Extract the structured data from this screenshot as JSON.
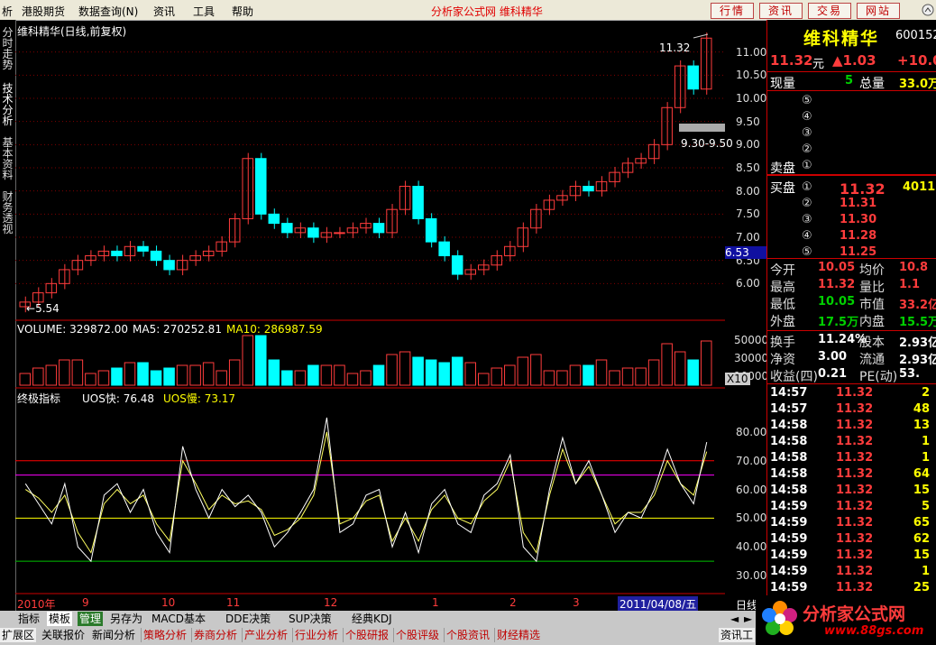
{
  "menubar": {
    "items": [
      "析",
      "港股期货",
      "数据查询(N)",
      "资讯",
      "工具",
      "帮助"
    ],
    "center_title": "分析家公式网  维科精华",
    "buttons": [
      "行情",
      "资讯",
      "交易",
      "网站"
    ]
  },
  "lefttabs": [
    "分时走势",
    "技术分析",
    "基本资料",
    "财务透视"
  ],
  "chart": {
    "price_title": "维科精华(日线,前复权)",
    "high_label": "11.32",
    "low_label": "5.54",
    "range_label": "9.30-9.50",
    "price_ticks": [
      "11.00",
      "10.50",
      "10.00",
      "9.50",
      "9.00",
      "8.50",
      "8.00",
      "7.50",
      "7.00",
      "6.50",
      "6.00"
    ],
    "cursor_price": "6.53",
    "volume_label": "VOLUME: 329872.00",
    "ma5_label": "MA5: 270252.81",
    "ma10_label": "MA10: 286987.59",
    "volume_ticks": [
      "50000",
      "30000",
      "10000"
    ],
    "volume_unit": "X10",
    "ind_title": "终极指标",
    "uos_fast": "UOS快: 76.48",
    "uos_slow": "UOS慢: 73.17",
    "ind_ticks": [
      "80.00",
      "70.00",
      "60.00",
      "50.00",
      "40.00",
      "30.00"
    ],
    "dates": [
      "2010年",
      "9",
      "10",
      "11",
      "12",
      "1",
      "2",
      "3"
    ],
    "cursor_date": "2011/04/08/五",
    "period": "日线"
  },
  "chart_data": {
    "type": "line",
    "title": "维科精华(日线,前复权)",
    "price": {
      "ylim": [
        5.5,
        11.5
      ],
      "high": 11.32,
      "low": 5.54,
      "values": [
        5.6,
        5.8,
        6.0,
        6.3,
        6.5,
        6.6,
        6.7,
        6.6,
        6.8,
        6.7,
        6.5,
        6.3,
        6.5,
        6.6,
        6.7,
        6.9,
        7.4,
        8.7,
        7.5,
        7.3,
        7.1,
        7.2,
        7.0,
        7.1,
        7.1,
        7.2,
        7.3,
        7.1,
        7.6,
        8.1,
        7.4,
        6.9,
        6.6,
        6.2,
        6.3,
        6.4,
        6.6,
        6.8,
        7.2,
        7.6,
        7.8,
        7.9,
        8.1,
        8.0,
        8.2,
        8.4,
        8.6,
        8.7,
        9.0,
        9.8,
        10.7,
        10.2,
        11.3
      ]
    },
    "uos": {
      "ylim": [
        25,
        90
      ],
      "lines": [
        35,
        50,
        65,
        70
      ],
      "fast": [
        62,
        55,
        48,
        62,
        40,
        35,
        58,
        62,
        52,
        60,
        45,
        38,
        75,
        60,
        50,
        60,
        54,
        58,
        52,
        40,
        45,
        52,
        60,
        85,
        45,
        48,
        58,
        60,
        40,
        52,
        38,
        55,
        60,
        48,
        45,
        58,
        62,
        72,
        40,
        35,
        60,
        78,
        62,
        70,
        58,
        45,
        52,
        50,
        60,
        74,
        62,
        55,
        76.48
      ],
      "slow": [
        60,
        57,
        52,
        58,
        45,
        38,
        55,
        60,
        55,
        58,
        48,
        42,
        70,
        62,
        53,
        58,
        55,
        56,
        53,
        44,
        46,
        50,
        58,
        80,
        48,
        50,
        56,
        58,
        42,
        50,
        42,
        53,
        58,
        50,
        48,
        56,
        60,
        70,
        45,
        38,
        58,
        74,
        62,
        68,
        58,
        48,
        52,
        52,
        58,
        70,
        62,
        58,
        73.17
      ]
    }
  },
  "rightpanel": {
    "name": "维科精华",
    "code": "600152",
    "price": "11.32",
    "unit": "元",
    "change": "▲1.03",
    "pct": "+10.0",
    "now_label": "现量",
    "now_val": "5",
    "total_label": "总量",
    "total_val": "33.0万",
    "sell_label": "卖盘",
    "buy_label": "买盘",
    "sell_levels": [
      "⑤",
      "④",
      "③",
      "②",
      "①"
    ],
    "buy_levels": [
      {
        "n": "①",
        "p": "11.32",
        "v": "4011"
      },
      {
        "n": "②",
        "p": "11.31",
        "v": ""
      },
      {
        "n": "③",
        "p": "11.30",
        "v": ""
      },
      {
        "n": "④",
        "p": "11.28",
        "v": ""
      },
      {
        "n": "⑤",
        "p": "11.25",
        "v": ""
      }
    ],
    "stats": [
      {
        "l1": "今开",
        "v1": "10.05",
        "l2": "均价",
        "v2": "10.8"
      },
      {
        "l1": "最高",
        "v1": "11.32",
        "l2": "量比",
        "v2": "1.1"
      },
      {
        "l1": "最低",
        "v1": "10.05",
        "l2": "市值",
        "v2": "33.2亿"
      },
      {
        "l1": "外盘",
        "v1": "17.5万",
        "l2": "内盘",
        "v2": "15.5万"
      }
    ],
    "fin": [
      {
        "l1": "换手",
        "v1": "11.24%",
        "l2": "股本",
        "v2": "2.93亿"
      },
      {
        "l1": "净资",
        "v1": "3.00",
        "l2": "流通",
        "v2": "2.93亿"
      },
      {
        "l1": "收益(四)",
        "v1": "0.21",
        "l2": "PE(动)",
        "v2": "53."
      }
    ],
    "ticks": [
      {
        "t": "14:57",
        "p": "11.32",
        "v": "2"
      },
      {
        "t": "14:57",
        "p": "11.32",
        "v": "48"
      },
      {
        "t": "14:58",
        "p": "11.32",
        "v": "13"
      },
      {
        "t": "14:58",
        "p": "11.32",
        "v": "1"
      },
      {
        "t": "14:58",
        "p": "11.32",
        "v": "1"
      },
      {
        "t": "14:58",
        "p": "11.32",
        "v": "64"
      },
      {
        "t": "14:58",
        "p": "11.32",
        "v": "15"
      },
      {
        "t": "14:59",
        "p": "11.32",
        "v": "5"
      },
      {
        "t": "14:59",
        "p": "11.32",
        "v": "65"
      },
      {
        "t": "14:59",
        "p": "11.32",
        "v": "62"
      },
      {
        "t": "14:59",
        "p": "11.32",
        "v": "15"
      },
      {
        "t": "14:59",
        "p": "11.32",
        "v": "1"
      },
      {
        "t": "14:59",
        "p": "11.32",
        "v": "25"
      }
    ]
  },
  "bottomtabs": {
    "row1": [
      "指标",
      "模板",
      "管理",
      "另存为",
      "MACD基本",
      "DDE决策",
      "SUP决策",
      "经典KDJ"
    ],
    "row2": [
      "扩展区",
      "关联报价",
      "新闻分析",
      "策略分析",
      "券商分析",
      "产业分析",
      "行业分析",
      "个股研报",
      "个股评级",
      "个股资讯",
      "财经精选"
    ],
    "right": "资讯工"
  },
  "logo": {
    "text": "分析家公式网",
    "url": "www.88gs.com"
  },
  "colors": {
    "up": "#ff3c3c",
    "down": "#00ffff",
    "menubg": "#ece9d8"
  }
}
